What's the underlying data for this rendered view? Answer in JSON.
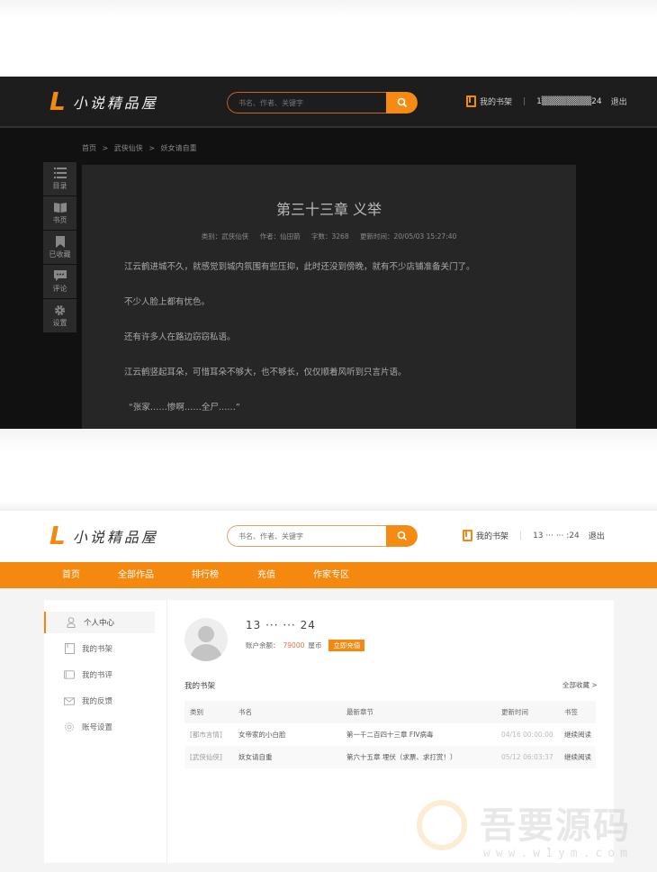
{
  "brand": {
    "logo_letter": "L",
    "name": "小说精品屋",
    "accent": "#f5890f"
  },
  "reader": {
    "search_placeholder": "书名、作者、关键字",
    "shelf_label": "我的书架",
    "user_masked": "1▒▒▒▒▒▒▒▒24",
    "logout_label": "退出",
    "breadcrumb": [
      "首页",
      ">",
      "武侠仙侠",
      ">",
      "妖女请自重"
    ],
    "toolbar": [
      {
        "icon": "list-icon",
        "label": "目录"
      },
      {
        "icon": "book-icon",
        "label": "书页"
      },
      {
        "icon": "bookmark-icon",
        "label": "已收藏"
      },
      {
        "icon": "comment-icon",
        "label": "评论"
      },
      {
        "icon": "gear-icon",
        "label": "设置"
      }
    ],
    "chapter": {
      "title": "第三十三章 义举",
      "meta": {
        "category": "类别：武侠仙侠",
        "author": "作者：仙田箭",
        "words": "字数：3268",
        "updated": "更新时间：20/05/03 15:27:40"
      },
      "paragraphs": [
        "江云鹤进城不久，就感觉到城内氛围有些压抑，此时还没到傍晚，就有不少店铺准备关门了。",
        "不少人脸上都有忧色。",
        "还有许多人在路边窃窃私语。",
        "江云鹤竖起耳朵，可惜耳朵不够大，也不够长，仅仅顺着风听到只言片语。",
        "“张家……惨啊……全尸……”"
      ]
    }
  },
  "center": {
    "search_placeholder": "书名、作者、关键字",
    "shelf_label": "我的书架",
    "user_masked": "13 ··· ··· :24",
    "logout_label": "退出",
    "nav": [
      "首页",
      "全部作品",
      "排行榜",
      "充值",
      "作家专区"
    ],
    "sidebar": [
      {
        "icon": "user-icon",
        "label": "个人中心",
        "active": true
      },
      {
        "icon": "bookshelf-icon",
        "label": "我的书架"
      },
      {
        "icon": "review-icon",
        "label": "我的书评"
      },
      {
        "icon": "mail-icon",
        "label": "我的反馈"
      },
      {
        "icon": "gear-icon",
        "label": "账号设置"
      }
    ],
    "profile": {
      "username_masked": "13 ··· ··· 24",
      "balance_label": "账户余额：",
      "balance_value": "79000",
      "currency": "屋币",
      "recharge_label": "立即充值"
    },
    "bookshelf": {
      "title": "我的书架",
      "all_link": "全部收藏 >",
      "columns": [
        "类别",
        "书名",
        "最新章节",
        "更新时间",
        "书签"
      ],
      "rows": [
        {
          "category": "[都市言情]",
          "book": "女帝家的小白脸",
          "latest": "第一千二百四十三章 FIV病毒",
          "updated": "04/16 00:00:00",
          "bookmark": "继续阅读"
        },
        {
          "category": "[武侠仙侠]",
          "book": "妖女请自重",
          "latest": "第六十五章 埋伏（求票、求打赏！）",
          "updated": "05/12 06:03:37",
          "bookmark": "继续阅读"
        }
      ]
    }
  },
  "watermark": {
    "cn": "吾要源码",
    "url": "www.w1ym.com"
  }
}
